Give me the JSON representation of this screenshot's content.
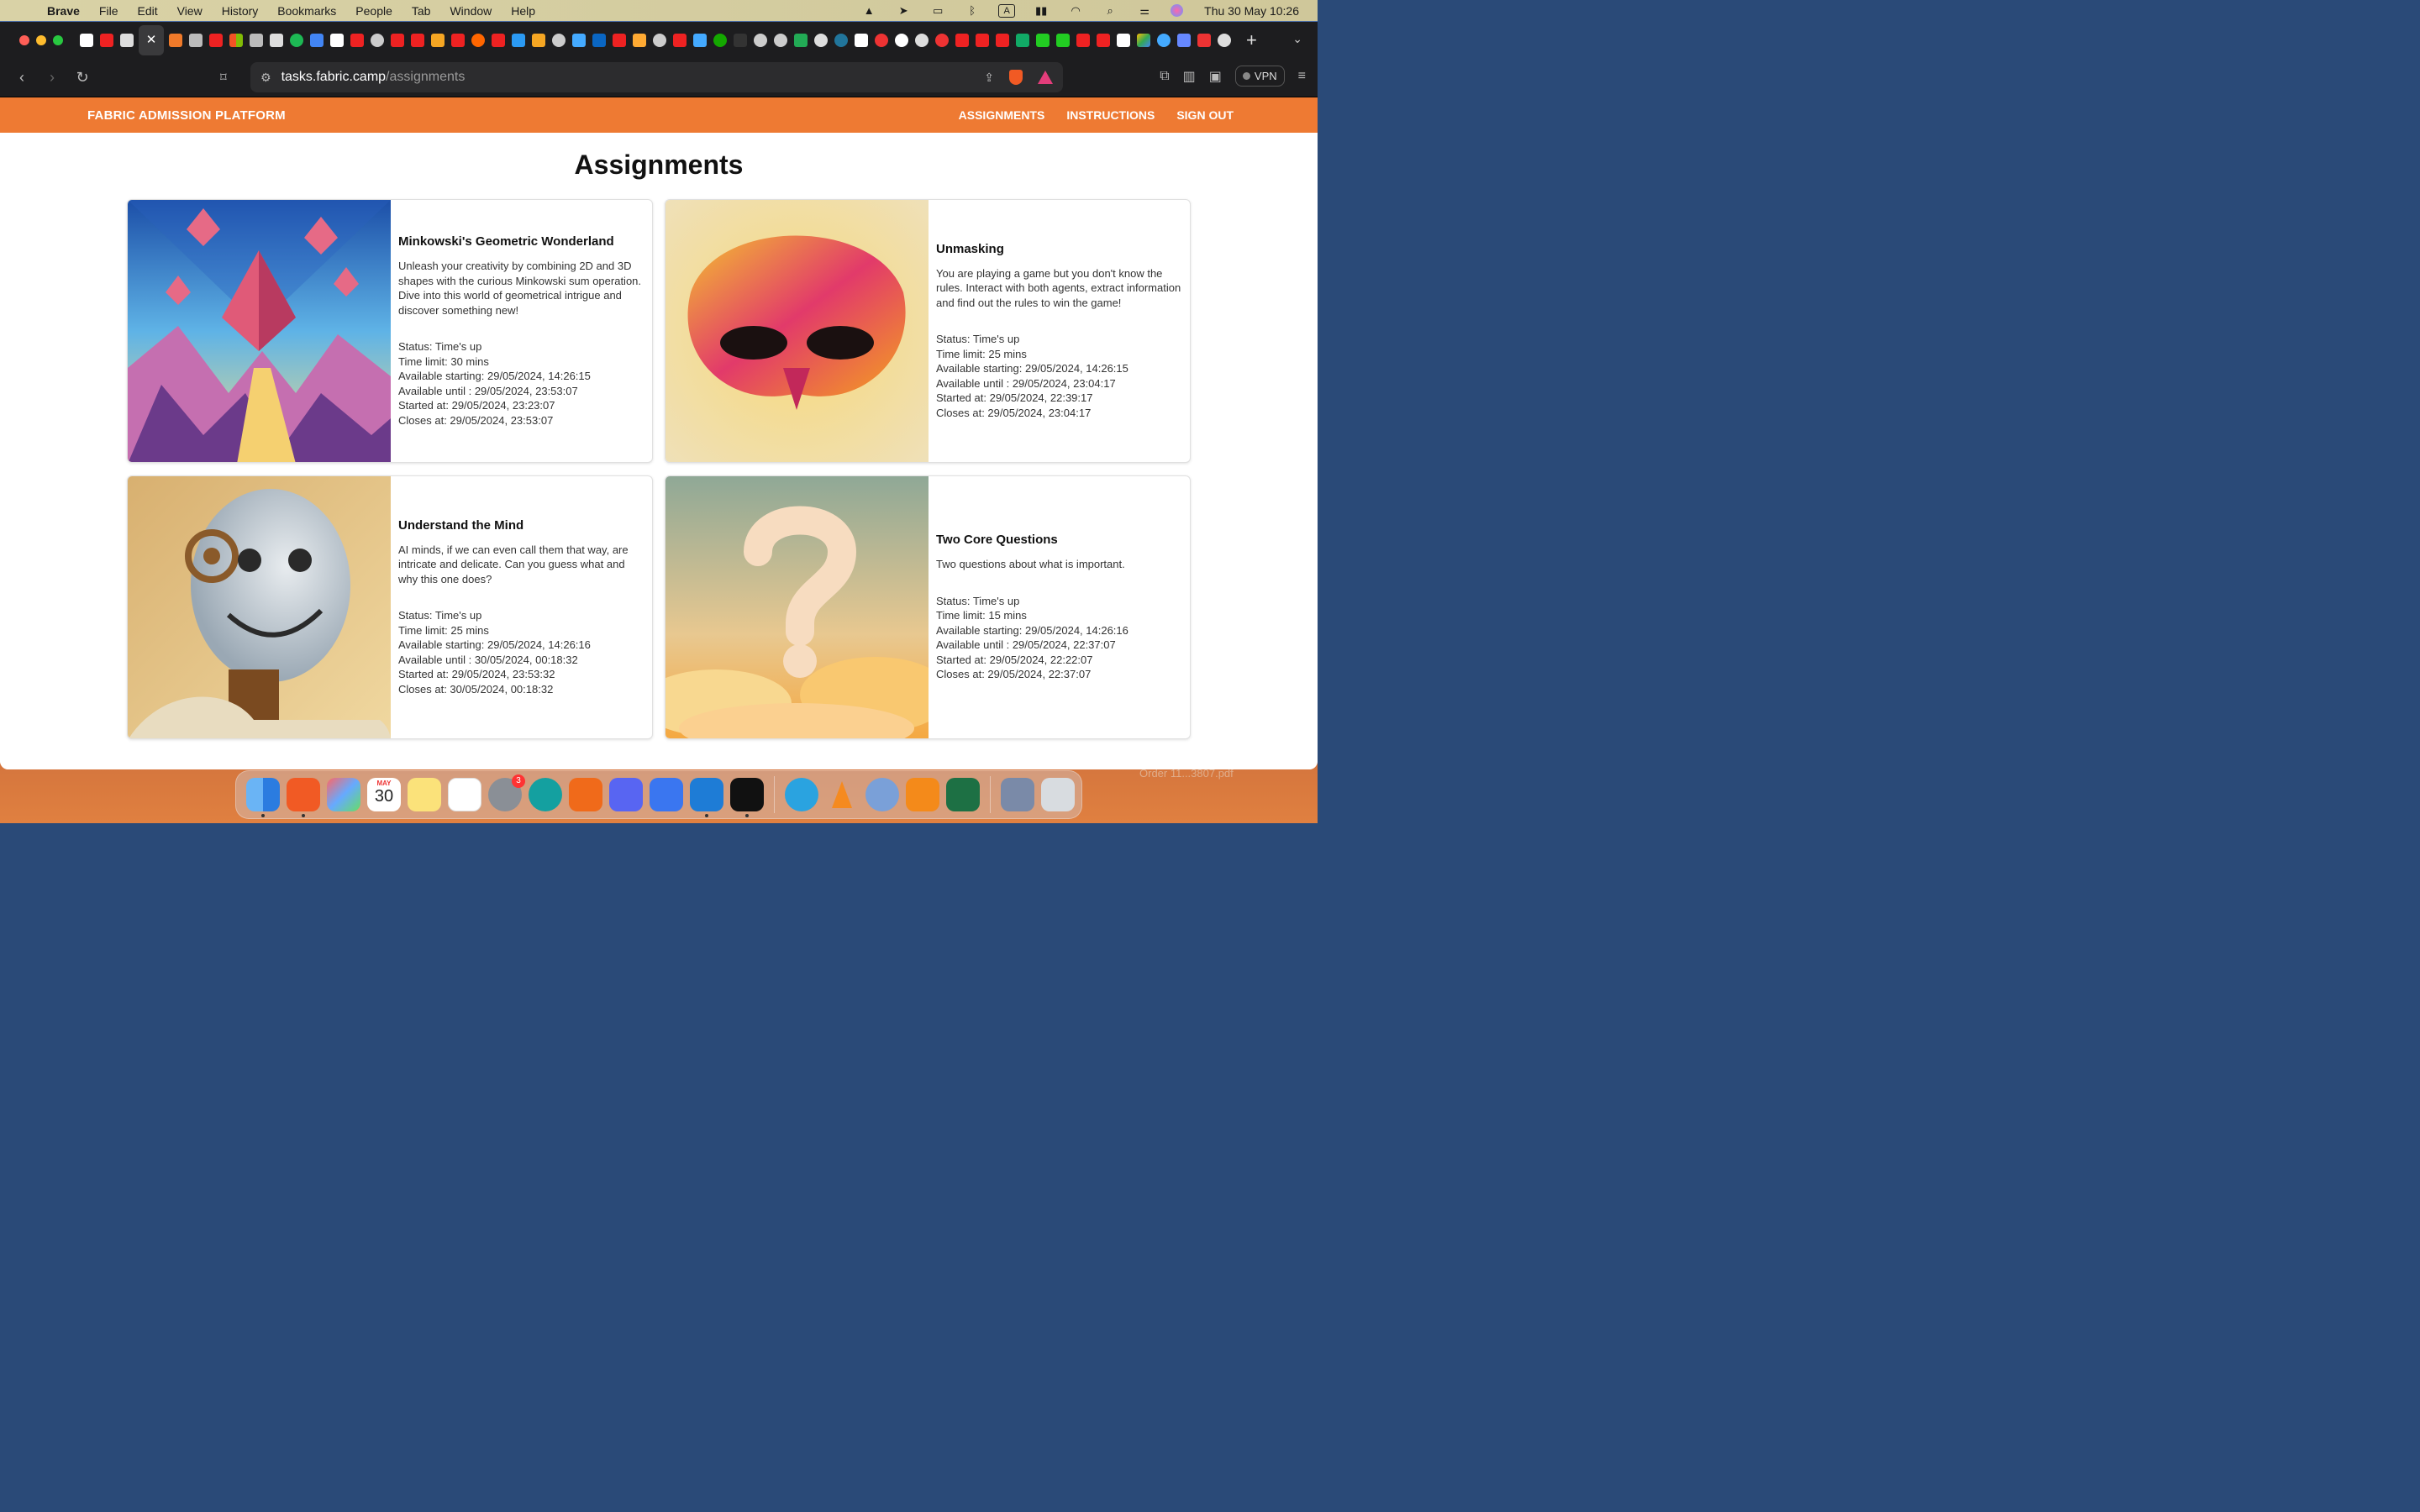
{
  "menubar": {
    "app": "Brave",
    "items": [
      "File",
      "Edit",
      "View",
      "History",
      "Bookmarks",
      "People",
      "Tab",
      "Window",
      "Help"
    ],
    "clock": "Thu 30 May  10:26"
  },
  "browser": {
    "url_host": "tasks.fabric.camp",
    "url_path": "/assignments",
    "vpn_label": "VPN"
  },
  "site": {
    "brand": "FABRIC ADMISSION PLATFORM",
    "nav": [
      "ASSIGNMENTS",
      "INSTRUCTIONS",
      "SIGN OUT"
    ],
    "title": "Assignments"
  },
  "assignments": [
    {
      "title": "Minkowski's Geometric Wonderland",
      "description": "Unleash your creativity by combining 2D and 3D shapes with the curious Minkowski sum operation. Dive into this world of geometrical intrigue and discover something new!",
      "status": "Status: Time's up",
      "time_limit": "Time limit: 30 mins",
      "available_starting": "Available starting: 29/05/2024, 14:26:15",
      "available_until": "Available until : 29/05/2024, 23:53:07",
      "started_at": "Started at: 29/05/2024, 23:23:07",
      "closes_at": "Closes at: 29/05/2024, 23:53:07"
    },
    {
      "title": "Unmasking",
      "description": "You are playing a game but you don't know the rules. Interact with both agents, extract information and find out the rules to win the game!",
      "status": "Status: Time's up",
      "time_limit": "Time limit: 25 mins",
      "available_starting": "Available starting: 29/05/2024, 14:26:15",
      "available_until": "Available until : 29/05/2024, 23:04:17",
      "started_at": "Started at: 29/05/2024, 22:39:17",
      "closes_at": "Closes at: 29/05/2024, 23:04:17"
    },
    {
      "title": "Understand the Mind",
      "description": "AI minds, if we can even call them that way, are intricate and delicate. Can you guess what and why this one does?",
      "status": "Status: Time's up",
      "time_limit": "Time limit: 25 mins",
      "available_starting": "Available starting: 29/05/2024, 14:26:16",
      "available_until": "Available until : 30/05/2024, 00:18:32",
      "started_at": "Started at: 29/05/2024, 23:53:32",
      "closes_at": "Closes at: 30/05/2024, 00:18:32"
    },
    {
      "title": "Two Core Questions",
      "description": "Two questions about what is important.",
      "status": "Status: Time's up",
      "time_limit": "Time limit: 15 mins",
      "available_starting": "Available starting: 29/05/2024, 14:26:16",
      "available_until": "Available until : 29/05/2024, 22:37:07",
      "started_at": "Started at: 29/05/2024, 22:22:07",
      "closes_at": "Closes at: 29/05/2024, 22:37:07"
    }
  ],
  "dock": {
    "calendar_month": "MAY",
    "calendar_day": "30",
    "settings_badge": "3"
  },
  "desktop_file": "Order 11...3807.pdf",
  "colors": {
    "accent": "#ee7a33"
  }
}
